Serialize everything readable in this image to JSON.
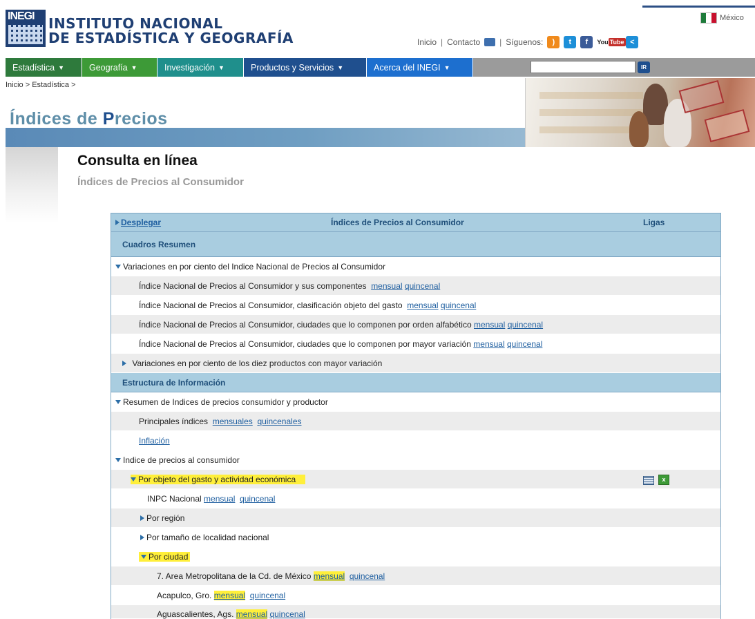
{
  "header": {
    "logo_text": "INEGI",
    "institution_line1": "INSTITUTO NACIONAL",
    "institution_line2": "DE ESTADÍSTICA Y GEOGRAFÍA",
    "country": "México",
    "links": {
      "inicio": "Inicio",
      "sep1": "|",
      "contacto": "Contacto",
      "sep2": "|",
      "siguenos": "Síguenos:"
    },
    "youtube_label_1": "You",
    "youtube_label_2": "Tube"
  },
  "nav": {
    "items": [
      {
        "label": "Estadística"
      },
      {
        "label": "Geografía"
      },
      {
        "label": "Investigación"
      },
      {
        "label": "Productos y Servicios"
      },
      {
        "label": "Acerca del INEGI"
      }
    ],
    "search_value": "",
    "search_button": "IR"
  },
  "breadcrumb": "Inicio > Estadística >",
  "banner": {
    "title_part1": "Índices de ",
    "title_part2": "P",
    "title_part3": "recios"
  },
  "main": {
    "heading": "Consulta en línea",
    "subheading": "Índices de Precios al Consumidor"
  },
  "table": {
    "header": {
      "expand": "Desplegar",
      "title": "Índices de Precios al Consumidor",
      "links_col": "Ligas"
    },
    "section1": "Cuadros Resumen",
    "group1": "Variaciones en por ciento del Indice Nacional de Precios al Consumidor",
    "g1_rows": [
      {
        "text": "Índice Nacional de Precios al Consumidor y sus componentes",
        "l1": "mensual",
        "l2": "quincenal"
      },
      {
        "text": "Índice Nacional de Precios al Consumidor, clasificación objeto del gasto",
        "l1": "mensual",
        "l2": "quincenal"
      },
      {
        "text": "Índice Nacional de Precios al Consumidor, ciudades que lo componen por orden alfabético",
        "l1": "mensual",
        "l2": "quincenal"
      },
      {
        "text": "Índice Nacional de Precios al Consumidor, ciudades que lo componen por mayor variación",
        "l1": "mensual",
        "l2": "quincenal"
      }
    ],
    "g1_collapsed": "Variaciones en por ciento de los diez productos con mayor variación",
    "section2": "Estructura de Información",
    "group2": "Resumen de Indices de precios consumidor y productor",
    "g2_row1": {
      "text": "Principales índices",
      "l1": "mensuales",
      "l2": "quincenales"
    },
    "g2_row2": "Inflación",
    "group3": "Indice de precios al consumidor",
    "g3_sub1": "Por objeto del gasto y actividad económica",
    "inpc": {
      "text": "INPC Nacional",
      "l1": "mensual",
      "l2": "quincenal"
    },
    "por_region": "Por región",
    "por_tamano": "Por tamaño de localidad nacional",
    "por_ciudad": "Por ciudad",
    "cities": [
      {
        "text": "7. Area Metropolitana de la Cd. de México",
        "l1": "mensual",
        "l2": "quincenal"
      },
      {
        "text": "Acapulco, Gro.",
        "l1": "mensual",
        "l2": "quincenal"
      },
      {
        "text": "Aguascalientes, Ags.",
        "l1": "mensual",
        "l2": "quincenal"
      }
    ]
  },
  "colors": {
    "nav1": "#2e7a3c",
    "nav2": "#3d9a37",
    "nav3": "#1f8f8c",
    "nav4": "#1f4f8e",
    "nav5": "#1d6fcf",
    "table_header": "#a9cde0",
    "highlight": "#ffef3a",
    "link": "#1f5fa0"
  }
}
